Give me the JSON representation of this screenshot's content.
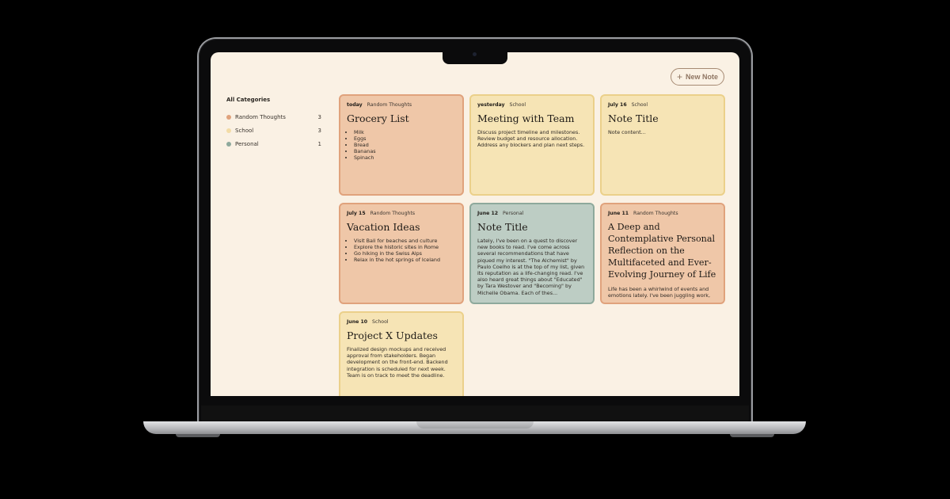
{
  "toolbar": {
    "new_note_icon": "plus-icon",
    "new_note_label": "New Note"
  },
  "sidebar": {
    "title": "All Categories",
    "categories": [
      {
        "label": "Random Thoughts",
        "count": "3",
        "color": "#e0a27c"
      },
      {
        "label": "School",
        "count": "3",
        "color": "#f3dca6"
      },
      {
        "label": "Personal",
        "count": "1",
        "color": "#8ea99c"
      }
    ]
  },
  "notes": [
    {
      "date": "today",
      "category": "Random Thoughts",
      "title": "Grocery List",
      "items": [
        "Milk",
        "Eggs",
        "Bread",
        "Bananas",
        "Spinach"
      ]
    },
    {
      "date": "yesterday",
      "category": "School",
      "title": "Meeting with Team",
      "body": "Discuss project timeline and milestones. Review budget and resource allocation. Address any blockers and plan next steps."
    },
    {
      "date": "July 16",
      "category": "School",
      "title": "Note Title",
      "body": "Note content..."
    },
    {
      "date": "July 15",
      "category": "Random Thoughts",
      "title": "Vacation Ideas",
      "items": [
        "Visit Bali for beaches and culture",
        "Explore the historic sites in Rome",
        "Go hiking in the Swiss Alps",
        "Relax in the hot springs of Iceland"
      ]
    },
    {
      "date": "June 12",
      "category": "Personal",
      "title": "Note Title",
      "body": "Lately, I've been on a quest to discover new books to read. I've come across several recommendations that have piqued my interest. \"The Alchemist\" by Paulo Coelho is at the top of my list, given its reputation as a life-changing read. I've also heard great things about \"Educated\" by Tara Westover and \"Becoming\" by Michelle Obama. Each of thes..."
    },
    {
      "date": "June 11",
      "category": "Random Thoughts",
      "title": "A Deep and Contemplative Personal Reflection on the Multifaceted and Ever-Evolving Journey of Life",
      "body": "Life has been a whirlwind of events and emotions lately. I've been juggling work,"
    },
    {
      "date": "June 10",
      "category": "School",
      "title": "Project X Updates",
      "body": "Finalized design mockups and received approval from stakeholders. Began development on the front-end. Backend integration is scheduled for next week. Team is on track to meet the deadline."
    }
  ]
}
